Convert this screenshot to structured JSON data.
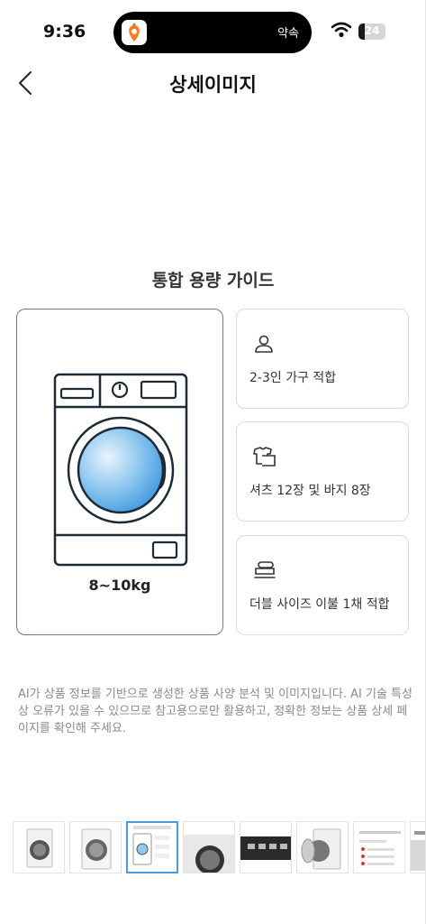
{
  "status_bar": {
    "time": "9:36",
    "live_activity_text": "약속",
    "battery_level": "24",
    "battery_fraction": 0.24
  },
  "header": {
    "title": "상세이미지"
  },
  "guide": {
    "title": "통합 용량 가이드",
    "capacity": "8~10kg",
    "cards": [
      {
        "icon": "person-icon",
        "label": "2-3인 가구 적합"
      },
      {
        "icon": "shirt-icon",
        "label": "셔츠 12장 및 바지 8장"
      },
      {
        "icon": "bedding-icon",
        "label": "더블 사이즈 이불 1채 적합"
      }
    ]
  },
  "disclaimer": "AI가 상품 정보를 기반으로 생성한 상품 사양 분석 및 이미지입니다. AI 기술 특성상 오류가 있을 수 있으므로 참고용으로만 활용하고, 정확한 정보는 상품 상세 페이지를 확인해 주세요.",
  "thumbnails": {
    "active_index": 2,
    "count": 8
  },
  "colors": {
    "accent_blue": "#4a9bd8",
    "drum_blue": "#5aaee8",
    "outline": "#1e2a36"
  }
}
